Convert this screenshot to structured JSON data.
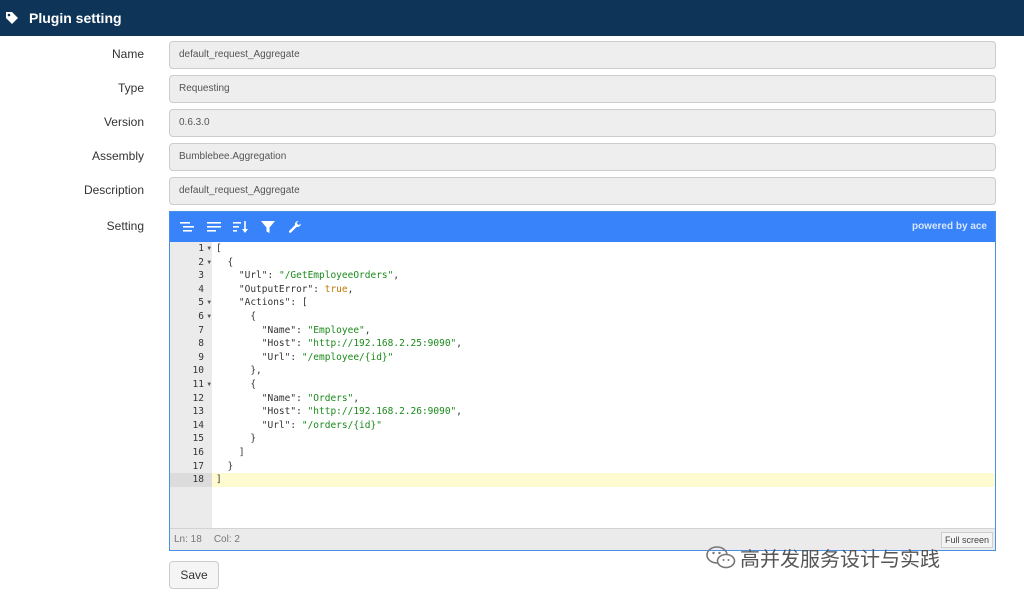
{
  "header": {
    "title": "Plugin setting",
    "icon": "tag-icon"
  },
  "fields": [
    {
      "label": "Name",
      "value": "default_request_Aggregate"
    },
    {
      "label": "Type",
      "value": "Requesting"
    },
    {
      "label": "Version",
      "value": "0.6.3.0"
    },
    {
      "label": "Assembly",
      "value": "Bumblebee.Aggregation"
    },
    {
      "label": "Description",
      "value": "default_request_Aggregate"
    }
  ],
  "setting": {
    "label": "Setting",
    "toolbar": {
      "buttons": [
        "format-icon",
        "compact-icon",
        "sort-icon",
        "filter-icon",
        "wrench-icon"
      ],
      "powered_by": "powered by ace",
      "color": "#3883fa"
    },
    "line_numbers": [
      "1",
      "2",
      "3",
      "4",
      "5",
      "6",
      "7",
      "8",
      "9",
      "10",
      "11",
      "12",
      "13",
      "14",
      "15",
      "16",
      "17",
      "18"
    ],
    "code_lines": [
      "[",
      "  {",
      "    \"Url\": \"/GetEmployeeOrders\",",
      "    \"OutputError\": true,",
      "    \"Actions\": [",
      "      {",
      "        \"Name\": \"Employee\",",
      "        \"Host\": \"http://192.168.2.25:9090\",",
      "        \"Url\": \"/employee/{id}\"",
      "      },",
      "      {",
      "        \"Name\": \"Orders\",",
      "        \"Host\": \"http://192.168.2.26:9090\",",
      "        \"Url\": \"/orders/{id}\"",
      "      }",
      "    ]",
      "  }",
      "]"
    ],
    "status": {
      "ln": "Ln: 18",
      "col": "Col: 2"
    },
    "fullscreen_label": "Full screen"
  },
  "save_label": "Save",
  "watermark": "高并发服务设计与实践"
}
